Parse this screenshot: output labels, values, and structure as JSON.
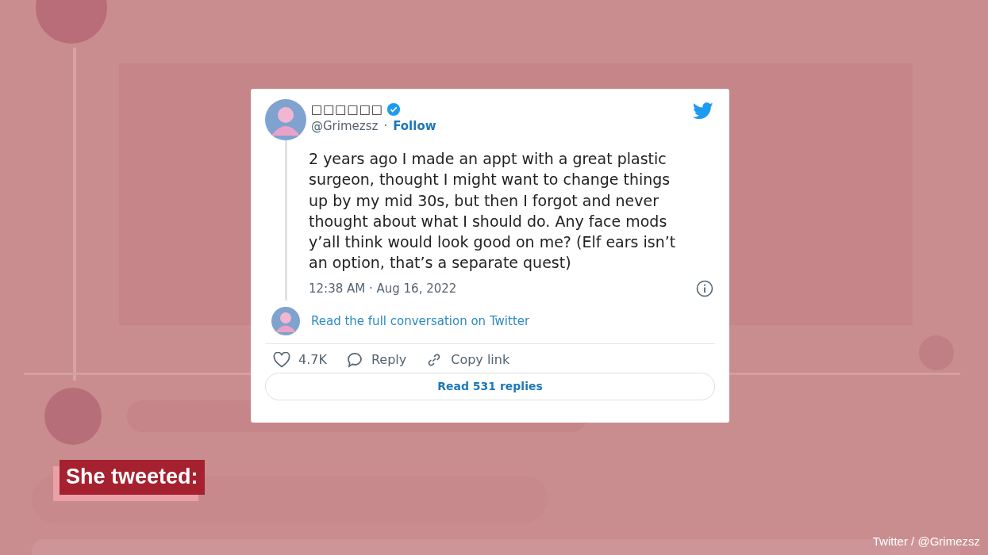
{
  "tweet": {
    "display_name": "□□□□□□",
    "verified": true,
    "handle": "@Grimezsz",
    "separator": "·",
    "follow": "Follow",
    "lines": [
      "2 years ago I made an appt with a great plastic",
      "surgeon, thought I might want to change things",
      "up by my mid 30s, but then I forgot and never",
      "thought about what I should do. Any face mods",
      "y’all think would look good on me?  (Elf ears isn’t",
      "an option, that’s a separate quest)"
    ],
    "timestamp": "12:38 AM · Aug 16, 2022",
    "conversation_link": "Read the full conversation on Twitter",
    "actions": [
      {
        "kind": "like",
        "label": "4.7K"
      },
      {
        "kind": "reply",
        "label": "Reply"
      },
      {
        "kind": "link",
        "label": "Copy link"
      }
    ],
    "replies_button": "Read 531 replies"
  },
  "caption": "She tweeted:",
  "credit": "Twitter / @Grimezsz"
}
